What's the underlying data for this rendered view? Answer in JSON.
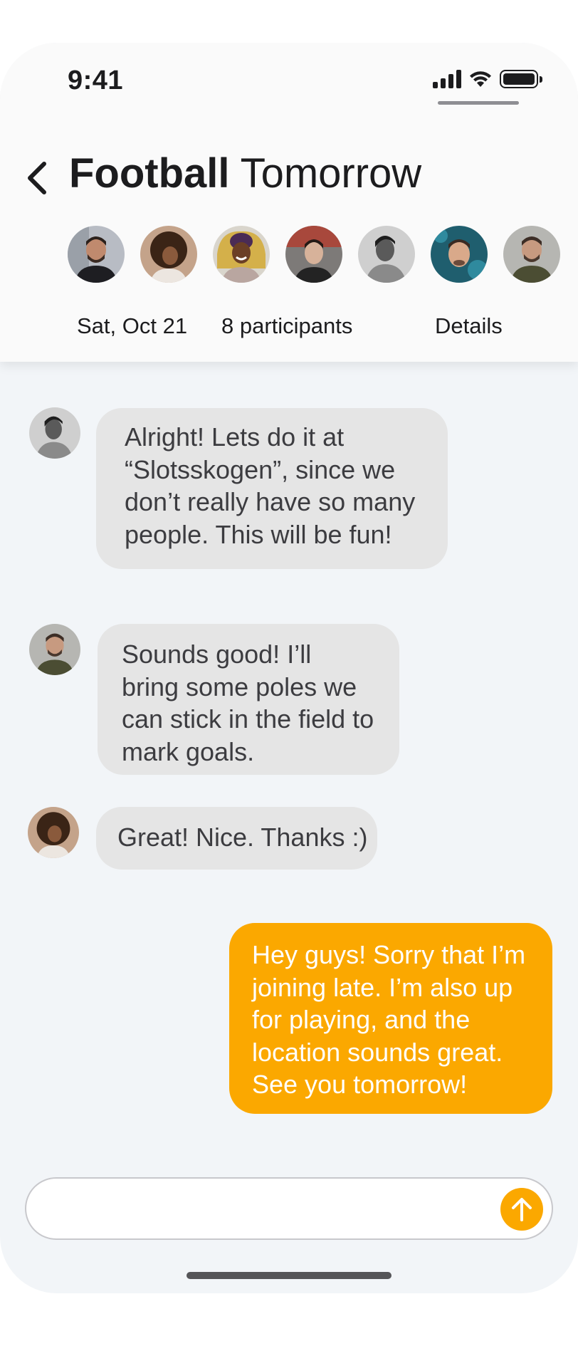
{
  "status": {
    "time": "9:41"
  },
  "header": {
    "title_bold": "Football",
    "title_rest": "Tomorrow",
    "date": "Sat, Oct 21",
    "participants": "8 participants",
    "details": "Details"
  },
  "messages": [
    {
      "sender": "participant",
      "text": "Alright! Lets do it at “Slotsskogen”, since we don’t really have so many people. This will be fun!"
    },
    {
      "sender": "participant",
      "text": "Sounds good! I’ll bring some poles we can stick in the field to mark goals."
    },
    {
      "sender": "participant",
      "text": "Great! Nice. Thanks :)"
    },
    {
      "sender": "me",
      "text": "Hey guys! Sorry that I’m joining late. I’m also up for playing, and the location sounds great. See you tomorrow!"
    }
  ],
  "composer": {
    "value": ""
  },
  "colors": {
    "accent": "#fba800",
    "bubble_incoming": "#e5e5e5",
    "background": "#f2f5f8"
  },
  "icons": {
    "back": "chevron-left-icon",
    "send": "arrow-up-icon",
    "signal": "cellular-signal-icon",
    "wifi": "wifi-icon",
    "battery": "battery-icon"
  }
}
